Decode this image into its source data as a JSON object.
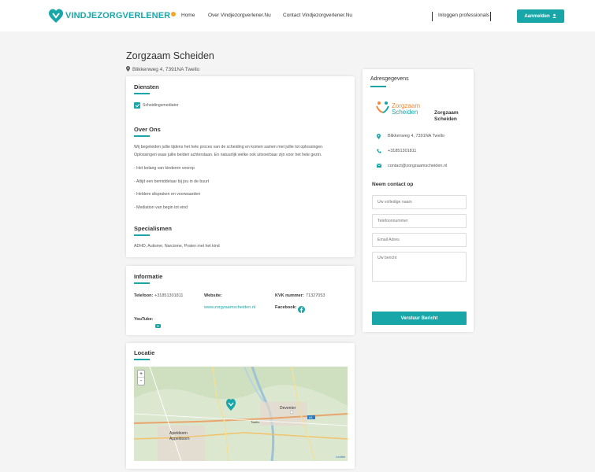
{
  "header": {
    "logo_text": "VINDJEZORGVERLENER",
    "nav": [
      "Home",
      "Over Vindjezorgverlener.Nu",
      "Contact Vindjezorgverlener.Nu"
    ],
    "login_professionals": "Inloggen professionals",
    "register_label": "Aanmelden"
  },
  "profile": {
    "title": "Zorgzaam Scheiden",
    "address": "Blikkenweg 4, 7391NA Twello"
  },
  "services": {
    "heading": "Diensten",
    "items": [
      "Scheidingsmediator"
    ]
  },
  "about": {
    "heading": "Over Ons",
    "paragraph": [
      "Wij begeleiden jullie tijdens het hele proces van de scheiding en komen samen met jullie tot oplossingen.",
      "Oplossingen waar jullie beiden achterstaan. En natuurlijk welke ook uitvoerbaar zijn voor het hele gezin."
    ],
    "bullets": [
      "- Het belang van kinderen voorop",
      "- Altijd een bemiddelaar bij jou in de buurt",
      "- Heldere afspraken en voorwaarden",
      "- Mediation van begin tot eind"
    ]
  },
  "specialisms": {
    "heading": "Specialismen",
    "text": "ADHD, Autisme, Narcisme, Praten met het kind"
  },
  "information": {
    "heading": "Informatie",
    "phone_label": "Telefoon:",
    "phone_value": "+31851301811",
    "website_label": "Website:",
    "website_value": "www.zorgzaamscheiden.nl",
    "kvk_label": "KVK nummer:",
    "kvk_value": "71327053",
    "facebook_label": "Facebook:",
    "youtube_label": "YouTube:"
  },
  "location": {
    "heading": "Locatie",
    "map_labels": [
      "Deventer",
      "Twello",
      "Apeldoorn",
      "Appeldoorn",
      "A1",
      "Leaflet"
    ],
    "zoom_in": "+",
    "zoom_out": "-"
  },
  "sidebar": {
    "heading": "Adresgegevens",
    "company_logo_line1": "Zorgzaam",
    "company_logo_line2": "Scheiden",
    "company_name_line1": "Zorgzaam",
    "company_name_line2": "Scheiden",
    "address": "Blikkenweg 4, 7391NA Twello",
    "phone": "+31851301811",
    "email": "contact@zorgzaamscheiden.nl",
    "contact_heading": "Neem contact op",
    "form": {
      "name_placeholder": "Uw volledige naam",
      "phone_placeholder": "Telefoonnummer",
      "email_placeholder": "Email Adres",
      "message_placeholder": "Uw bericht",
      "submit_label": "Verstuur Bericht"
    }
  },
  "colors": {
    "accent": "#18a6a8",
    "logo_orange": "#f5a623",
    "background": "#f4f4f4"
  }
}
